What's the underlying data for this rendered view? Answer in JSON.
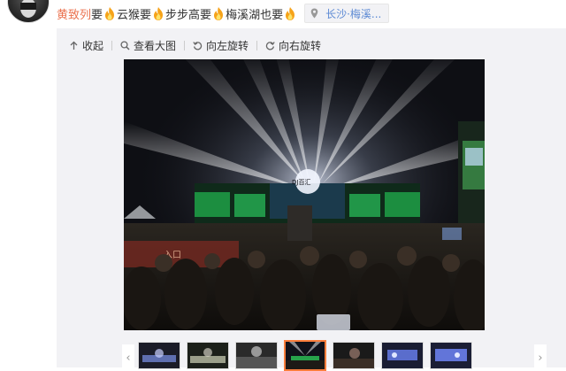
{
  "post": {
    "username": "黄致列",
    "segments": [
      "要",
      "云猴要",
      "步步高要",
      "梅溪湖也要"
    ],
    "emoji": "fire-emoji",
    "location": "长沙·梅溪..."
  },
  "toolbar": {
    "collapse": "收起",
    "view_large": "查看大图",
    "rotate_left": "向左旋转",
    "rotate_right": "向右旋转"
  },
  "photo": {
    "description_icon": "concert-photo",
    "stage_sign": "DJ百汇"
  },
  "thumbnails": {
    "count": 7,
    "active_index": 3,
    "prev_icon": "chevron-left-icon",
    "next_icon": "chevron-right-icon",
    "prev_glyph": "‹",
    "next_glyph": "›"
  },
  "colors": {
    "username": "#eb7350",
    "location": "#5d8ad4",
    "active_thumb": "#fa7d3c",
    "panel_bg": "#f2f2f5"
  }
}
